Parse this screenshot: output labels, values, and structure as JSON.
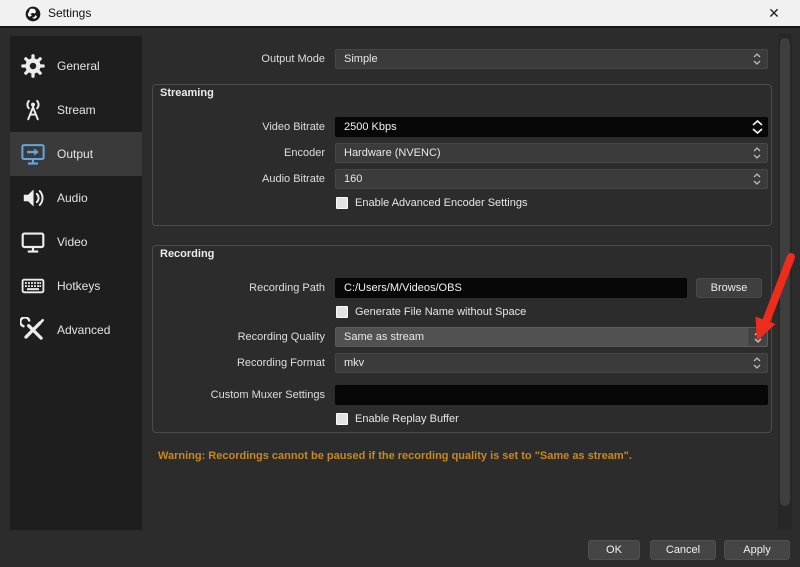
{
  "window": {
    "title": "Settings",
    "close_glyph": "✕"
  },
  "sidebar": {
    "items": [
      {
        "label": "General",
        "icon": "gear-icon",
        "selected": false
      },
      {
        "label": "Stream",
        "icon": "broadcast-icon",
        "selected": false
      },
      {
        "label": "Output",
        "icon": "monitor-arrow-icon",
        "selected": true
      },
      {
        "label": "Audio",
        "icon": "speaker-icon",
        "selected": false
      },
      {
        "label": "Video",
        "icon": "display-icon",
        "selected": false
      },
      {
        "label": "Hotkeys",
        "icon": "keyboard-icon",
        "selected": false
      },
      {
        "label": "Advanced",
        "icon": "tools-icon",
        "selected": false
      }
    ]
  },
  "content": {
    "output_mode": {
      "label": "Output Mode",
      "value": "Simple"
    },
    "streaming": {
      "title": "Streaming",
      "video_bitrate": {
        "label": "Video Bitrate",
        "value": "2500 Kbps"
      },
      "encoder": {
        "label": "Encoder",
        "value": "Hardware (NVENC)"
      },
      "audio_bitrate": {
        "label": "Audio Bitrate",
        "value": "160"
      },
      "advanced_encoder_checkbox": {
        "label": "Enable Advanced Encoder Settings",
        "checked": false
      }
    },
    "recording": {
      "title": "Recording",
      "path": {
        "label": "Recording Path",
        "value": "C:/Users/M/Videos/OBS",
        "browse_label": "Browse"
      },
      "filename_checkbox": {
        "label": "Generate File Name without Space",
        "checked": false
      },
      "quality": {
        "label": "Recording Quality",
        "value": "Same as stream"
      },
      "format": {
        "label": "Recording Format",
        "value": "mkv"
      },
      "muxer": {
        "label": "Custom Muxer Settings",
        "value": ""
      },
      "replay_checkbox": {
        "label": "Enable Replay Buffer",
        "checked": false
      }
    },
    "warning": "Warning: Recordings cannot be paused if the recording quality is set to \"Same as stream\"."
  },
  "footer": {
    "ok": "OK",
    "cancel": "Cancel",
    "apply": "Apply"
  },
  "colors": {
    "titlebar": "#f1f1f1",
    "window_bg": "#2c2c2c",
    "sidebar_bg": "#1e1e1e",
    "selected_item_bg": "#3a3a3a",
    "accent_blue": "#63a5dc",
    "warning_orange": "#c9881c",
    "annotation_arrow_red": "#ee2c1c",
    "input_dark": "#070707",
    "combo_gray": "#3b3b3b",
    "combo_hover": "#515151"
  }
}
